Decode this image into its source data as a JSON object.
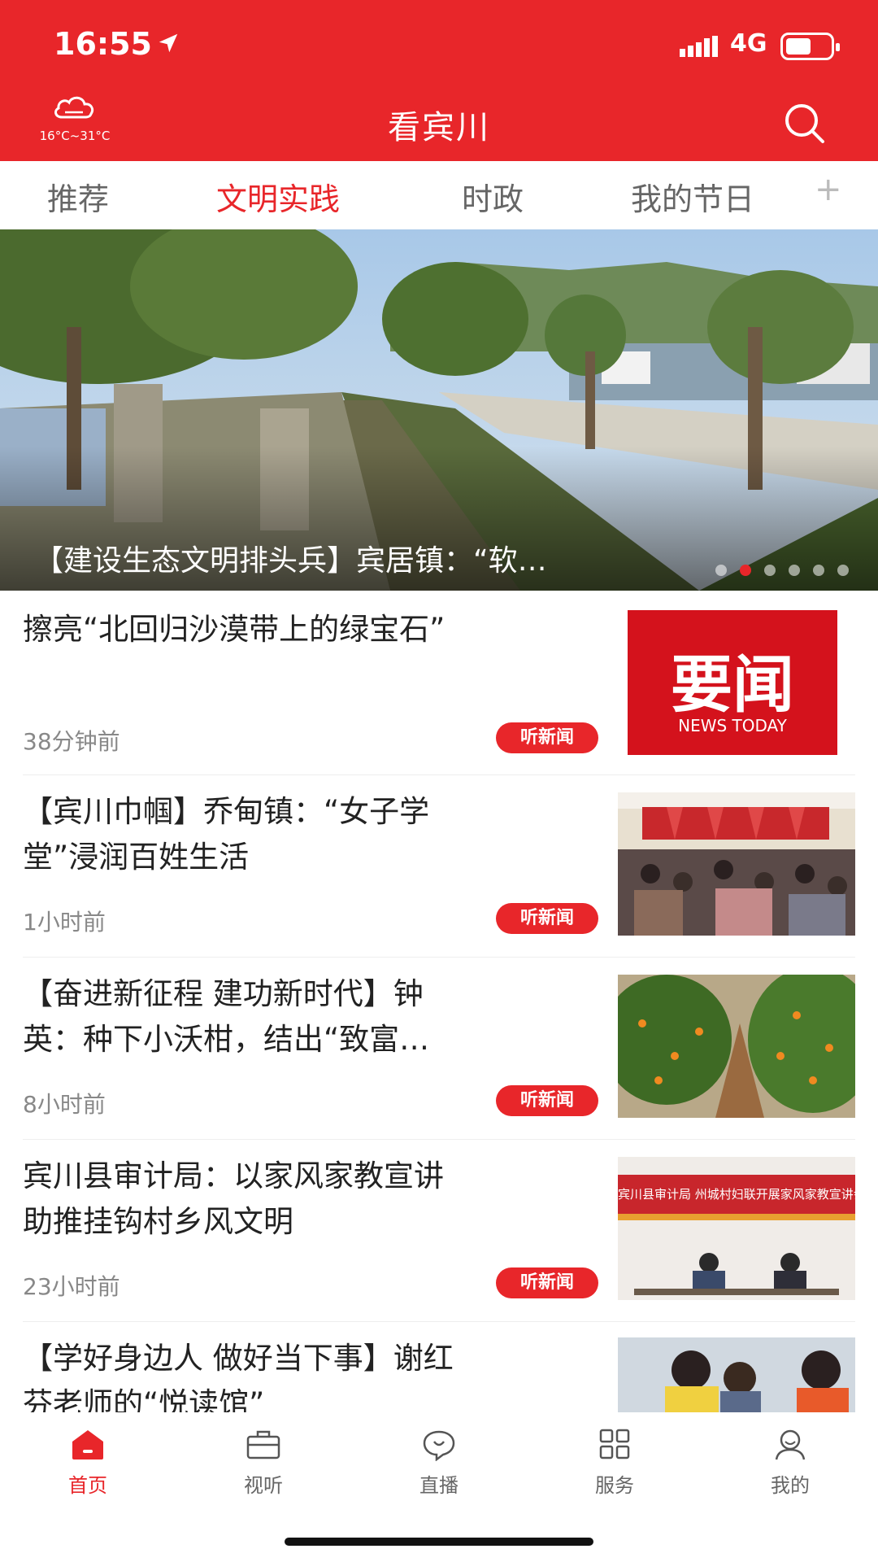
{
  "status": {
    "time": "16:55",
    "network": "4G",
    "battery_level": 0.55
  },
  "header": {
    "weather_temp": "16°C~31°C",
    "title": "看宾川"
  },
  "tabs": {
    "items": [
      "推荐",
      "文明实践",
      "时政",
      "我的节日"
    ],
    "active_index": 1
  },
  "banner": {
    "caption": "【建设生态文明排头兵】宾居镇：“软…",
    "slide_count": 6,
    "active_slide": 1
  },
  "news": [
    {
      "title_line1": "擦亮“北回归沙漠带上的绿宝石”",
      "title_line2": "",
      "time": "38分钟前",
      "listen": "听新闻",
      "thumb_text": "要闻",
      "thumb_sub": "NEWS TODAY"
    },
    {
      "title_line1": "【宾川巾帼】乔甸镇：“女子学",
      "title_line2": "堂”浸润百姓生活",
      "time": "1小时前",
      "listen": "听新闻"
    },
    {
      "title_line1": "【奋进新征程  建功新时代】钟",
      "title_line2": "英：种下小沃柑，结出“致富…",
      "time": "8小时前",
      "listen": "听新闻"
    },
    {
      "title_line1": "宾川县审计局：以家风家教宣讲",
      "title_line2": "助推挂钩村乡风文明",
      "time": "23小时前",
      "listen": "听新闻",
      "thumb_banner": "宾川县审计局 州城村妇联开展家风家教宣讲会"
    },
    {
      "title_line1": "【学好身边人 做好当下事】谢红",
      "title_line2": "芬老师的“悦读馆”"
    }
  ],
  "tabbar": {
    "items": [
      "首页",
      "视听",
      "直播",
      "服务",
      "我的"
    ],
    "active_index": 0
  },
  "colors": {
    "brand": "#e8262a"
  }
}
